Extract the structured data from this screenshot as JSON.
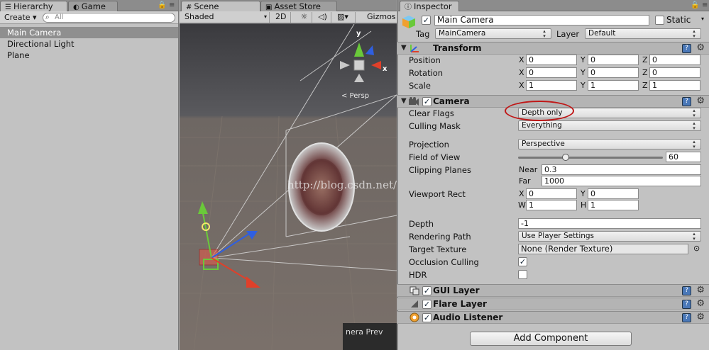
{
  "hierarchy": {
    "tab_label": "Hierarchy",
    "create_label": "Create ▾",
    "search_placeholder": "All",
    "items": [
      "Main Camera",
      "Directional Light",
      "Plane"
    ]
  },
  "game": {
    "tab_label": "Game"
  },
  "scene": {
    "tab_label": "Scene",
    "shading_label": "Shaded",
    "mode_2d": "2D",
    "gizmos_label": "Gizmos",
    "axis_y": "y",
    "axis_x": "x",
    "persp_label": "< Persp",
    "camera_preview_label": "nera Prev"
  },
  "asset_store": {
    "tab_label": "Asset Store"
  },
  "inspector": {
    "tab_label": "Inspector",
    "object_name": "Main Camera",
    "static_label": "Static",
    "tag_label": "Tag",
    "tag_value": "MainCamera",
    "layer_label": "Layer",
    "layer_value": "Default",
    "transform": {
      "title": "Transform",
      "position": {
        "label": "Position",
        "x": "0",
        "y": "0",
        "z": "0"
      },
      "rotation": {
        "label": "Rotation",
        "x": "0",
        "y": "0",
        "z": "0"
      },
      "scale": {
        "label": "Scale",
        "x": "1",
        "y": "1",
        "z": "1"
      }
    },
    "camera": {
      "title": "Camera",
      "clear_flags_label": "Clear Flags",
      "clear_flags_value": "Depth only",
      "culling_mask_label": "Culling Mask",
      "culling_mask_value": "Everything",
      "projection_label": "Projection",
      "projection_value": "Perspective",
      "fov_label": "Field of View",
      "fov_value": "60",
      "fov_fraction": 0.33,
      "clipping_label": "Clipping Planes",
      "near_label": "Near",
      "near_value": "0.3",
      "far_label": "Far",
      "far_value": "1000",
      "viewport_label": "Viewport Rect",
      "vp_x": "0",
      "vp_y": "0",
      "vp_w": "1",
      "vp_h": "1",
      "depth_label": "Depth",
      "depth_value": "-1",
      "rendering_path_label": "Rendering Path",
      "rendering_path_value": "Use Player Settings",
      "target_texture_label": "Target Texture",
      "target_texture_value": "None (Render Texture)",
      "occlusion_label": "Occlusion Culling",
      "hdr_label": "HDR"
    },
    "gui_layer": "GUI Layer",
    "flare_layer": "Flare Layer",
    "audio_listener": "Audio Listener",
    "add_component": "Add Component"
  },
  "watermark": "http://blog.csdn.net/",
  "colors": {
    "panel_bg": "#c2c2c2",
    "selection": "#8f8f8f",
    "annotation_circle": "#c01818",
    "gizmo_red": "#e0402a",
    "gizmo_green": "#6ac93a",
    "gizmo_blue": "#2f5fe0"
  }
}
